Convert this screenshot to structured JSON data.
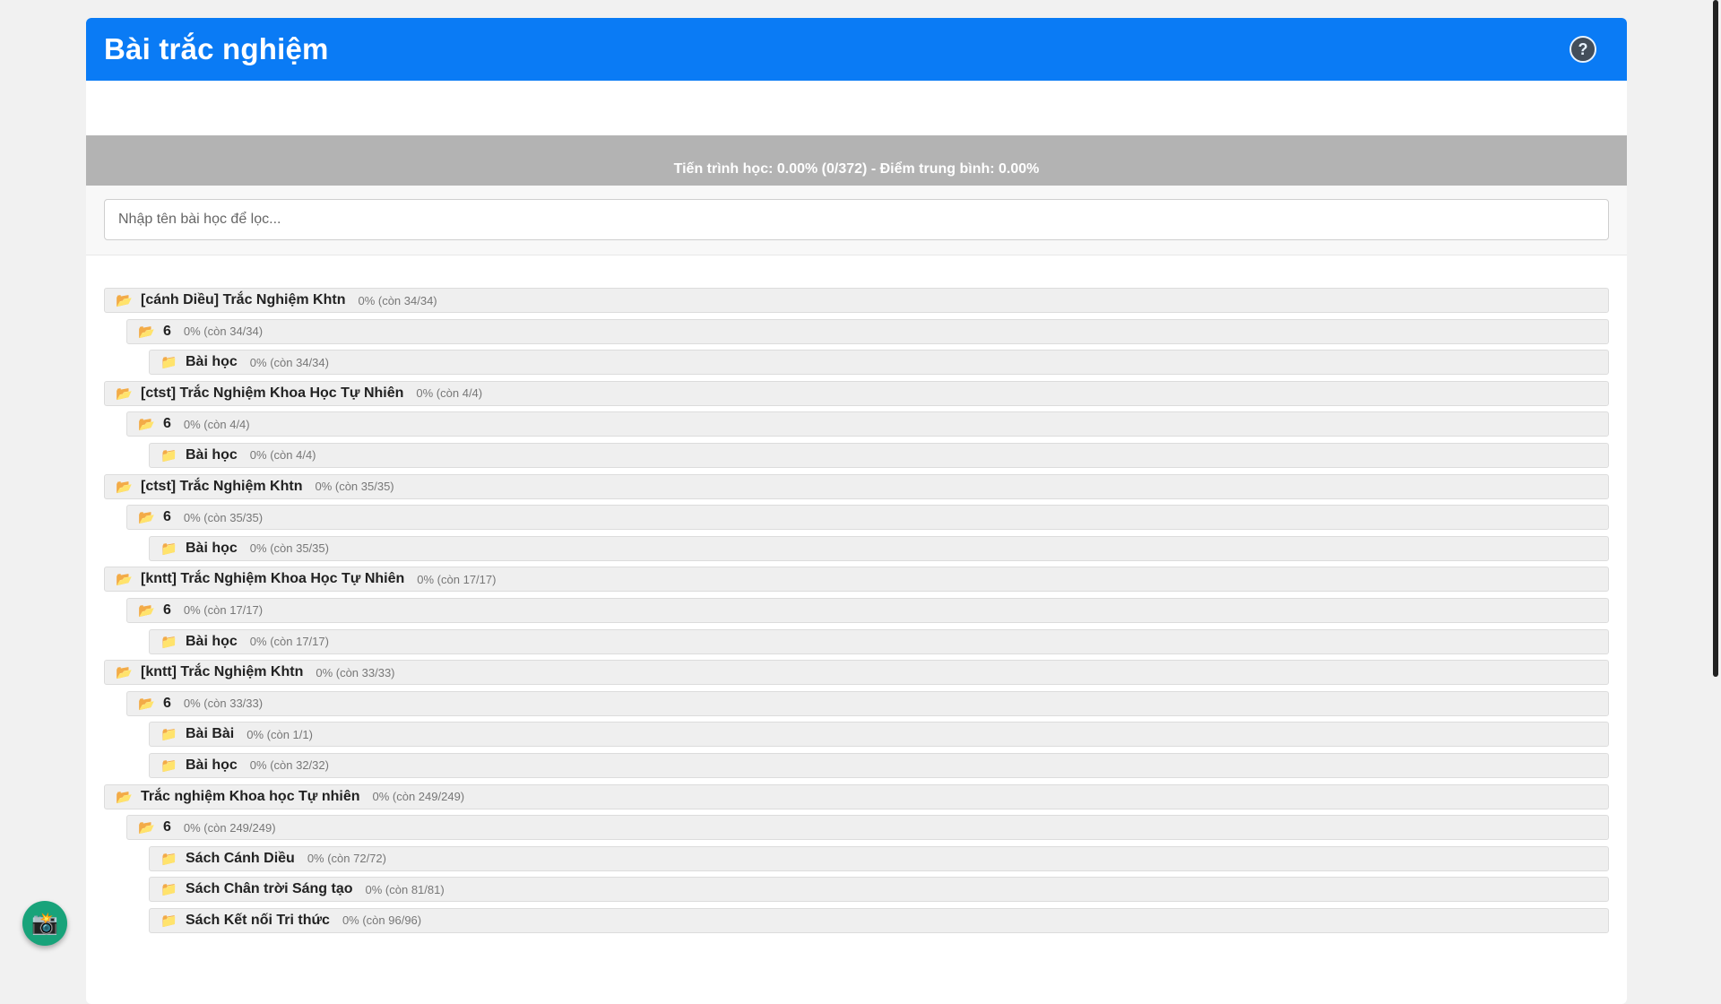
{
  "header": {
    "title": "Bài trắc nghiệm",
    "help_label": "?"
  },
  "progress": {
    "text": "Tiến trình học: 0.00% (0/372) - Điểm trung bình: 0.00%",
    "fraction": 0.0
  },
  "filter": {
    "placeholder": "Nhập tên bài học để lọc...",
    "value": ""
  },
  "tree": [
    {
      "level": 0,
      "icon": "📂",
      "name": "[cánh Diều] Trắc Nghiệm Khtn",
      "stat": "0% (còn 34/34)"
    },
    {
      "level": 1,
      "icon": "📂",
      "name": "6",
      "stat": "0% (còn 34/34)"
    },
    {
      "level": 2,
      "icon": "📁",
      "name": "Bài học",
      "stat": "0% (còn 34/34)"
    },
    {
      "level": 0,
      "icon": "📂",
      "name": "[ctst] Trắc Nghiệm Khoa Học Tự Nhiên",
      "stat": "0% (còn 4/4)"
    },
    {
      "level": 1,
      "icon": "📂",
      "name": "6",
      "stat": "0% (còn 4/4)"
    },
    {
      "level": 2,
      "icon": "📁",
      "name": "Bài học",
      "stat": "0% (còn 4/4)"
    },
    {
      "level": 0,
      "icon": "📂",
      "name": "[ctst] Trắc Nghiệm Khtn",
      "stat": "0% (còn 35/35)"
    },
    {
      "level": 1,
      "icon": "📂",
      "name": "6",
      "stat": "0% (còn 35/35)"
    },
    {
      "level": 2,
      "icon": "📁",
      "name": "Bài học",
      "stat": "0% (còn 35/35)"
    },
    {
      "level": 0,
      "icon": "📂",
      "name": "[kntt] Trắc Nghiệm Khoa Học Tự Nhiên",
      "stat": "0% (còn 17/17)"
    },
    {
      "level": 1,
      "icon": "📂",
      "name": "6",
      "stat": "0% (còn 17/17)"
    },
    {
      "level": 2,
      "icon": "📁",
      "name": "Bài học",
      "stat": "0% (còn 17/17)"
    },
    {
      "level": 0,
      "icon": "📂",
      "name": "[kntt] Trắc Nghiệm Khtn",
      "stat": "0% (còn 33/33)"
    },
    {
      "level": 1,
      "icon": "📂",
      "name": "6",
      "stat": "0% (còn 33/33)"
    },
    {
      "level": 2,
      "icon": "📁",
      "name": "Bài Bài",
      "stat": "0% (còn 1/1)"
    },
    {
      "level": 2,
      "icon": "📁",
      "name": "Bài học",
      "stat": "0% (còn 32/32)"
    },
    {
      "level": 0,
      "icon": "📂",
      "name": "Trắc nghiệm Khoa học Tự nhiên",
      "stat": "0% (còn 249/249)"
    },
    {
      "level": 1,
      "icon": "📂",
      "name": "6",
      "stat": "0% (còn 249/249)"
    },
    {
      "level": 2,
      "icon": "📁",
      "name": "Sách Cánh Diều",
      "stat": "0% (còn 72/72)"
    },
    {
      "level": 2,
      "icon": "📁",
      "name": "Sách Chân trời Sáng tạo",
      "stat": "0% (còn 81/81)"
    },
    {
      "level": 2,
      "icon": "📁",
      "name": "Sách Kết nối Tri thức",
      "stat": "0% (còn 96/96)"
    }
  ],
  "fab": {
    "icon": "📸"
  }
}
